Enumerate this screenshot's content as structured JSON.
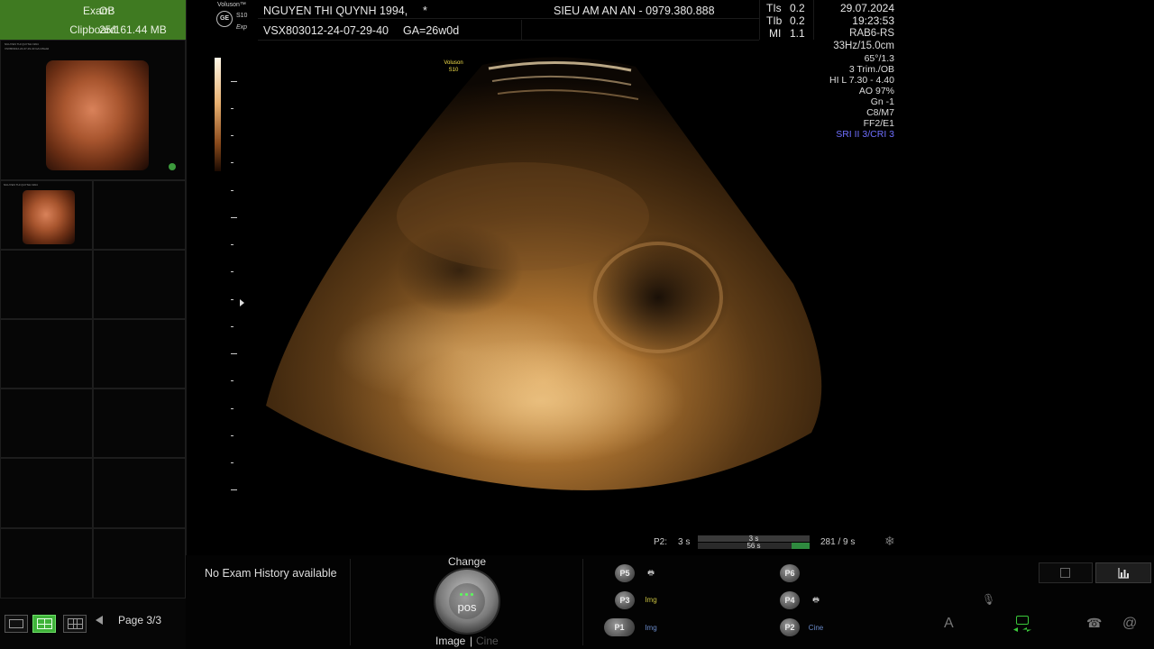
{
  "left_panel": {
    "exam_label": "Exam:",
    "exam_value": "OB",
    "clipboard_label": "Clipboard:",
    "clipboard_value": "25/161.44 MB",
    "thumbnails": [
      {
        "line1": "NGUYEN THI QUYNH 1994",
        "line2": "VSX803012-24-07-29-40 GA=26w0d"
      },
      {
        "line1": "NGUYEN THI QUYNH 1994",
        "line2": "VSX803012-24-07-29-40 GA=26w0d"
      }
    ],
    "page_label": "Page 3/3"
  },
  "header": {
    "brand_top": "Voluson™",
    "brand_model": "S10",
    "brand_exp": "Exp",
    "ge_logo": "GE",
    "patient_name": "NGUYEN THI QUYNH 1994,",
    "patient_marker": "*",
    "exam_id": "VSX803012-24-07-29-40",
    "ga": "GA=26w0d",
    "clinic": "SIEU AM AN AN - 0979.380.888",
    "tis_label": "TIs",
    "tis_value": "0.2",
    "tib_label": "TIb",
    "tib_value": "0.2",
    "mi_label": "MI",
    "mi_value": "1.1",
    "date": "29.07.2024",
    "time": "19:23:53"
  },
  "params": {
    "probe": "RAB6-RS",
    "frame": "33Hz/15.0cm",
    "angle": "65°/1.3",
    "preset": "3 Trim./OB",
    "hi": "HI L  7.30 - 4.40",
    "ao": "AO 97%",
    "gn": "Gn  -1",
    "cm": "C8/M7",
    "ff": "FF2/E1",
    "sri": "SRI II 3/CRI 3",
    "sri_color": "#6f6fff"
  },
  "image_label": {
    "line1": "Voluson",
    "line2": "S10"
  },
  "cine": {
    "label": "P2:",
    "left_time": "3 s",
    "bar_top": "3 s",
    "bar_bottom": "56 s",
    "count": "281 / 9 s"
  },
  "bottom": {
    "exam_history": "No Exam History available",
    "change_label": "Change",
    "pos_label": "pos",
    "image_label": "Image",
    "separator": "|",
    "cine_label": "Cine",
    "p_buttons": [
      "P5",
      "P3",
      "P1",
      "P6",
      "P4",
      "P2"
    ],
    "img_label": "Img",
    "cine_small": "Cine",
    "font_icon": "A",
    "at_icon": "@"
  }
}
